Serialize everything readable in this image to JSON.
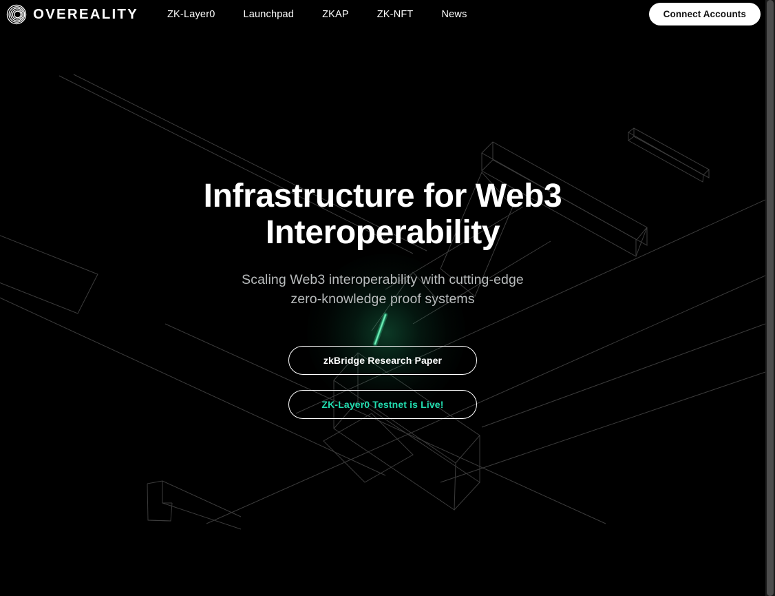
{
  "theme": {
    "background": "#000000",
    "text_primary": "#ffffff",
    "text_muted": "#b9bcbd",
    "accent_teal": "#22ddb0",
    "accent_green_glow": "#4ff5a8",
    "button_solid_bg": "#ffffff",
    "button_solid_text": "#111111",
    "wireframe_line": "#3a3a3a",
    "scrollbar_track": "#1b1b1b",
    "scrollbar_thumb": "#4d4d4d"
  },
  "header": {
    "logo": {
      "icon": "concentric-rings-spiral-icon",
      "text": "OVEREALITY"
    },
    "nav_items": [
      {
        "label": "ZK-Layer0"
      },
      {
        "label": "Launchpad"
      },
      {
        "label": "ZKAP"
      },
      {
        "label": "ZK-NFT"
      },
      {
        "label": "News"
      }
    ],
    "connect_button": {
      "label": "Connect Accounts"
    }
  },
  "hero": {
    "title_line1": "Infrastructure for Web3",
    "title_line2": "Interoperability",
    "subtitle_line1": "Scaling Web3 interoperability with cutting-edge",
    "subtitle_line2": "zero-knowledge proof systems",
    "cta_primary": {
      "label": "zkBridge Research Paper"
    },
    "cta_secondary": {
      "label": "ZK-Layer0 Testnet is Live!"
    }
  },
  "scrollbar": {
    "orientation": "vertical",
    "thumb_position": "top"
  }
}
